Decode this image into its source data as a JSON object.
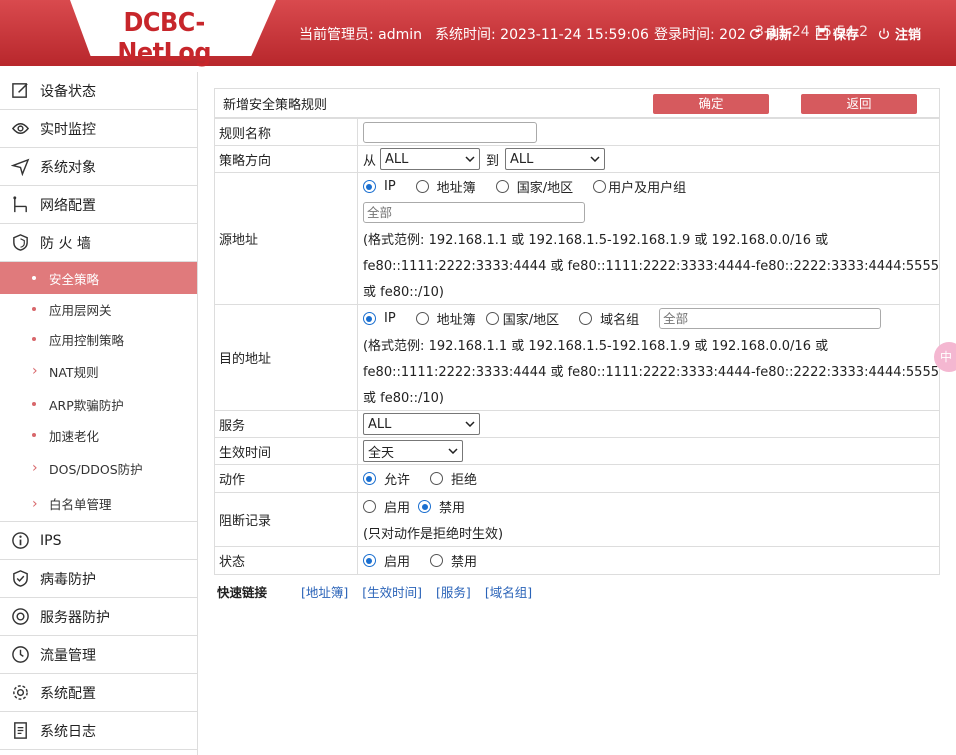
{
  "header": {
    "logo": "DCBC-NetLog",
    "admin_label": "当前管理员: admin",
    "system_time": "系统时间: 2023-11-24 15:59:06",
    "login_time": "登录时间: 202",
    "overlap_text": "3-11-24 15:54:2",
    "refresh": "刷新",
    "save": "保存",
    "logout": "注销"
  },
  "sidebar": {
    "items": [
      {
        "label": "设备状态",
        "icon": "edit-icon"
      },
      {
        "label": "实时监控",
        "icon": "eye-icon"
      },
      {
        "label": "系统对象",
        "icon": "send-icon"
      },
      {
        "label": "网络配置",
        "icon": "network-icon"
      },
      {
        "label": "防 火 墙",
        "icon": "shield-icon"
      }
    ],
    "sub_items": [
      {
        "label": "安全策略",
        "type": "bullet",
        "active": true
      },
      {
        "label": "应用层网关",
        "type": "bullet"
      },
      {
        "label": "应用控制策略",
        "type": "bullet"
      },
      {
        "label": "NAT规则",
        "type": "chevron"
      },
      {
        "label": "ARP欺骗防护",
        "type": "bullet"
      },
      {
        "label": "加速老化",
        "type": "bullet"
      },
      {
        "label": "DOS/DDOS防护",
        "type": "chevron"
      },
      {
        "label": "白名单管理",
        "type": "chevron"
      }
    ],
    "items_after": [
      {
        "label": "IPS",
        "icon": "info-icon"
      },
      {
        "label": "病毒防护",
        "icon": "shield-check-icon"
      },
      {
        "label": "服务器防护",
        "icon": "target-icon"
      },
      {
        "label": "流量管理",
        "icon": "clock-icon"
      },
      {
        "label": "系统配置",
        "icon": "gear-icon"
      },
      {
        "label": "系统日志",
        "icon": "log-icon"
      }
    ]
  },
  "panel": {
    "title": "新增安全策略规则",
    "confirm": "确定",
    "back": "返回"
  },
  "form": {
    "rule_name_label": "规则名称",
    "rule_name_value": "",
    "direction_label": "策略方向",
    "from": "从",
    "from_value": "ALL",
    "to": "到",
    "to_value": "ALL",
    "src_label": "源地址",
    "src_options": [
      "IP",
      "地址簿",
      "国家/地区",
      "用户及用户组"
    ],
    "src_placeholder": "全部",
    "src_fmt": [
      "(格式范例: 192.168.1.1 或 192.168.1.5-192.168.1.9 或 192.168.0.0/16 或",
      "fe80::1111:2222:3333:4444 或 fe80::1111:2222:3333:4444-fe80::2222:3333:4444:5555",
      "或 fe80::/10)"
    ],
    "dst_label": "目的地址",
    "dst_options": [
      "IP",
      "地址簿",
      "国家/地区",
      "域名组"
    ],
    "dst_placeholder": "全部",
    "dst_fmt": [
      "(格式范例: 192.168.1.1 或 192.168.1.5-192.168.1.9 或 192.168.0.0/16 或",
      "fe80::1111:2222:3333:4444 或 fe80::1111:2222:3333:4444-fe80::2222:3333:4444:5555",
      "或 fe80::/10)"
    ],
    "service_label": "服务",
    "service_value": "ALL",
    "time_label": "生效时间",
    "time_value": "全天",
    "action_label": "动作",
    "action_allow": "允许",
    "action_deny": "拒绝",
    "block_label": "阻断记录",
    "block_on": "启用",
    "block_off": "禁用",
    "block_note": "(只对动作是拒绝时生效)",
    "status_label": "状态",
    "status_on": "启用",
    "status_off": "禁用"
  },
  "quick": {
    "label": "快速链接",
    "links": [
      "[地址簿]",
      "[生效时间]",
      "[服务]",
      "[域名组]"
    ]
  },
  "side_tab": "中"
}
